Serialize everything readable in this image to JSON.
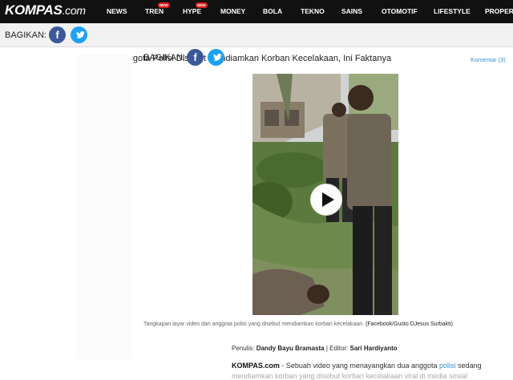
{
  "topnav": {
    "logo_main": "KOMPAS",
    "logo_domain": ".com",
    "items": [
      {
        "label": "NEWS",
        "badge": ""
      },
      {
        "label": "TREN",
        "badge": "NEW"
      },
      {
        "label": "HYPE",
        "badge": "NEW"
      },
      {
        "label": "MONEY",
        "badge": ""
      },
      {
        "label": "BOLA",
        "badge": ""
      },
      {
        "label": "TEKNO",
        "badge": ""
      },
      {
        "label": "SAINS",
        "badge": ""
      },
      {
        "label": "OTOMOTIF",
        "badge": ""
      },
      {
        "label": "LIFESTYLE",
        "badge": ""
      },
      {
        "label": "PROPERTI",
        "badge": ""
      }
    ]
  },
  "sharebar": {
    "label": "BAGIKAN:",
    "facebook_glyph": "f",
    "twitter_icon": "twitter-icon",
    "headline": "Viral Anggota Polisi Disebut Mendiamkan Korban Kecelakaan, Ini Faktanya"
  },
  "article": {
    "share_label": "BAGIKAN:",
    "comments": "Komentar (3)",
    "video_icon": "play-icon",
    "caption": "Tangkapan layar video dari anggota polisi yang disebut mendiamkan korban kecelakaan.",
    "caption_source": "(Facebook/Gusto DJesus Surbakti)",
    "author_prefix": "Penulis:",
    "author": "Dandy Bayu Bramasta",
    "editor_prefix": "| Editor:",
    "editor": "Sari Hardiyanto",
    "lead_brand": "KOMPAS.com",
    "lead_text": "- Sebuah video yang menayangkan dua anggota",
    "lead_keyword": "polisi",
    "lead_text2": "sedang",
    "lead_line2": "mendiamkan korban yang disebut korban kecelakaan viral di media sosial"
  },
  "colors": {
    "nav_bg": "#111111",
    "facebook": "#3b5998",
    "twitter": "#1da1f2",
    "link": "#3a8fd1"
  }
}
